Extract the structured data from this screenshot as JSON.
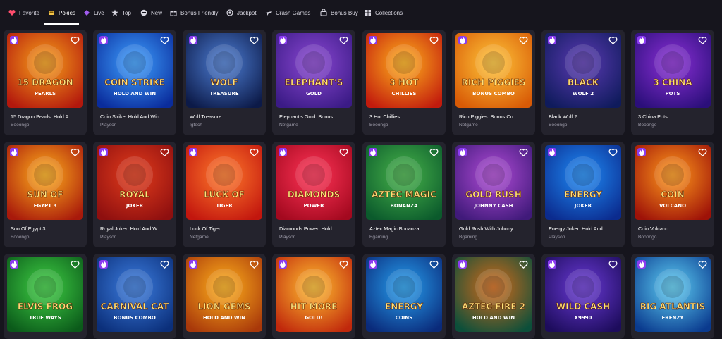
{
  "nav": {
    "items": [
      {
        "label": "Favorite",
        "icon": "heart-icon",
        "color": "#ff4d6d"
      },
      {
        "label": "Pokies",
        "icon": "pokies-icon",
        "color": "#f3c44b",
        "active": true
      },
      {
        "label": "Live",
        "icon": "live-icon",
        "color": "#a15cf0"
      },
      {
        "label": "Top",
        "icon": "star-icon",
        "color": "#d9d8e2"
      },
      {
        "label": "New",
        "icon": "new-icon",
        "color": "#d9d8e2"
      },
      {
        "label": "Bonus Friendly",
        "icon": "gift-icon",
        "color": "#d9d8e2"
      },
      {
        "label": "Jackpot",
        "icon": "jackpot-icon",
        "color": "#d9d8e2"
      },
      {
        "label": "Crash Games",
        "icon": "plane-icon",
        "color": "#d9d8e2"
      },
      {
        "label": "Bonus Buy",
        "icon": "bag-icon",
        "color": "#d9d8e2"
      },
      {
        "label": "Collections",
        "icon": "collections-icon",
        "color": "#d9d8e2"
      }
    ]
  },
  "games": [
    {
      "title": "15 Dragon Pearls: Hold A...",
      "provider": "Booongo",
      "art": [
        "15 DRAGON",
        "PEARLS"
      ],
      "bg": [
        "#b3180d",
        "#f7a11a"
      ]
    },
    {
      "title": "Coin Strike: Hold And Win",
      "provider": "Playson",
      "art": [
        "COIN STRIKE",
        "HOLD AND WIN"
      ],
      "bg": [
        "#0a2c9c",
        "#3ea0ff"
      ]
    },
    {
      "title": "Wolf Treasure",
      "provider": "Igtech",
      "art": [
        "WOLF",
        "TREASURE"
      ],
      "bg": [
        "#0c1a48",
        "#4e7fd6"
      ]
    },
    {
      "title": "Elephant's Gold: Bonus ...",
      "provider": "Netgame",
      "art": [
        "ELEPHANT'S",
        "GOLD"
      ],
      "bg": [
        "#3b1b86",
        "#8a47d2"
      ]
    },
    {
      "title": "3 Hot Chillies",
      "provider": "Booongo",
      "art": [
        "3 HOT",
        "CHILLIES"
      ],
      "bg": [
        "#c21b0d",
        "#ffb21c"
      ]
    },
    {
      "title": "Rich Piggies: Bonus Co...",
      "provider": "Netgame",
      "art": [
        "RICH PIGGIES",
        "BONUS COMBO"
      ],
      "bg": [
        "#d85a06",
        "#ffc63a"
      ]
    },
    {
      "title": "Black Wolf 2",
      "provider": "Booongo",
      "art": [
        "BLACK",
        "WOLF 2"
      ],
      "bg": [
        "#0f1b5c",
        "#5b3ab3"
      ]
    },
    {
      "title": "3 China Pots",
      "provider": "Booongo",
      "art": [
        "3 CHINA",
        "POTS"
      ],
      "bg": [
        "#2b0f7a",
        "#8b2fd6"
      ]
    },
    {
      "title": "Sun Of Egypt 3",
      "provider": "Booongo",
      "art": [
        "SUN OF",
        "EGYPT 3"
      ],
      "bg": [
        "#a8190b",
        "#ffb01c"
      ]
    },
    {
      "title": "Royal Joker: Hold And W...",
      "provider": "Playson",
      "art": [
        "ROYAL",
        "JOKER"
      ],
      "bg": [
        "#8e0f0f",
        "#e23c1c"
      ]
    },
    {
      "title": "Luck Of Tiger",
      "provider": "Netgame",
      "art": [
        "LUCK OF",
        "TIGER"
      ],
      "bg": [
        "#c2160e",
        "#ff7a2b"
      ]
    },
    {
      "title": "Diamonds Power: Hold ...",
      "provider": "Playson",
      "art": [
        "DIAMONDS",
        "POWER"
      ],
      "bg": [
        "#a3091f",
        "#ff3356"
      ]
    },
    {
      "title": "Aztec Magic Bonanza",
      "provider": "Bgaming",
      "art": [
        "AZTEC MAGIC",
        "BONANZA"
      ],
      "bg": [
        "#0b5a2c",
        "#47b34a"
      ]
    },
    {
      "title": "Gold Rush With Johnny ...",
      "provider": "Bgaming",
      "art": [
        "GOLD RUSH",
        "JOHNNY CASH"
      ],
      "bg": [
        "#401a7a",
        "#b04bd6"
      ]
    },
    {
      "title": "Energy Joker: Hold And ...",
      "provider": "Playson",
      "art": [
        "ENERGY",
        "JOKER"
      ],
      "bg": [
        "#0b2b8e",
        "#1f8bf5"
      ]
    },
    {
      "title": "Coin Volcano",
      "provider": "Booongo",
      "art": [
        "COIN",
        "VOLCANO"
      ],
      "bg": [
        "#9e1208",
        "#ff9a1c"
      ]
    },
    {
      "title": "",
      "provider": "",
      "art": [
        "ELVIS FROG",
        "TRUE WAYS"
      ],
      "bg": [
        "#0b5a1a",
        "#3fcf44"
      ]
    },
    {
      "title": "",
      "provider": "",
      "art": [
        "CARNIVAL CAT",
        "BONUS COMBO"
      ],
      "bg": [
        "#0b2f7a",
        "#3d7ee0"
      ]
    },
    {
      "title": "",
      "provider": "",
      "art": [
        "LION GEMS",
        "HOLD AND WIN"
      ],
      "bg": [
        "#a8380a",
        "#ffb11c"
      ]
    },
    {
      "title": "",
      "provider": "",
      "art": [
        "HIT MORE",
        "GOLD!"
      ],
      "bg": [
        "#c0280c",
        "#ffbf30"
      ]
    },
    {
      "title": "",
      "provider": "",
      "art": [
        "ENERGY",
        "COINS"
      ],
      "bg": [
        "#0a2a7a",
        "#27a0ef"
      ]
    },
    {
      "title": "",
      "provider": "",
      "art": [
        "AZTEC FIRE 2",
        "HOLD AND WIN"
      ],
      "bg": [
        "#0c4f3a",
        "#d46a1a"
      ]
    },
    {
      "title": "",
      "provider": "",
      "art": [
        "WILD CASH",
        "X9990"
      ],
      "bg": [
        "#1d0c5c",
        "#6a3ad6"
      ]
    },
    {
      "title": "",
      "provider": "",
      "art": [
        "BIG ATLANTIS",
        "FRENZY"
      ],
      "bg": [
        "#0a3a8e",
        "#5fd0f5"
      ]
    }
  ]
}
